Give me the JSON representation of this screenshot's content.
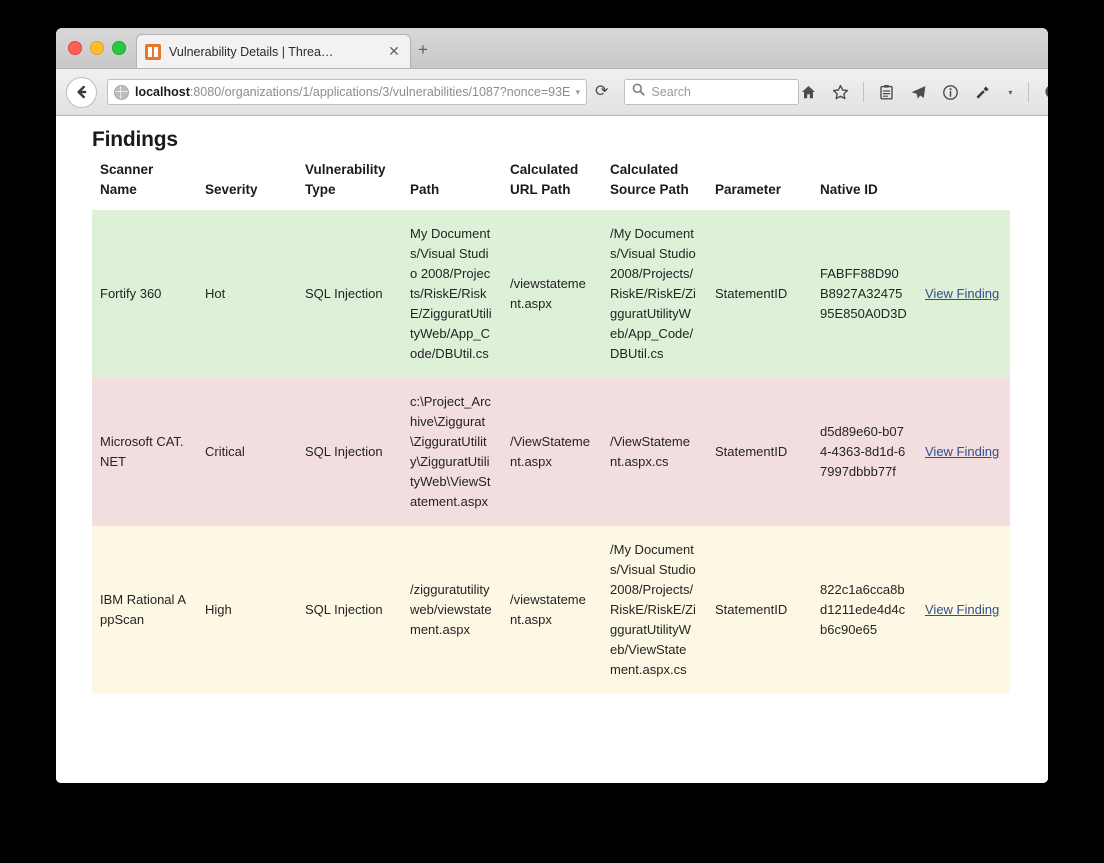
{
  "window": {
    "traffic_lights": [
      "close",
      "minimize",
      "zoom"
    ]
  },
  "tab": {
    "title": "Vulnerability Details | Threa…",
    "close_label": "✕",
    "newtab_label": "+",
    "favicon_name": "threadfix-favicon"
  },
  "navbar": {
    "back_label": "",
    "url_host": "localhost",
    "url_rest": ":8080/organizations/1/applications/3/vulnerabilities/1087?nonce=93E",
    "url_caret": "▾",
    "reload_label": "⟳",
    "search_placeholder": "Search",
    "icons": [
      {
        "name": "home-icon"
      },
      {
        "name": "bookmark-star-icon"
      },
      {
        "name": "reading-list-icon"
      },
      {
        "name": "pocket-send-icon"
      },
      {
        "name": "page-info-icon"
      },
      {
        "name": "addon-icon"
      },
      {
        "name": "dropdown-caret-icon",
        "label": "▾"
      },
      {
        "name": "feedback-smiley-icon"
      },
      {
        "name": "hamburger-menu-icon"
      }
    ]
  },
  "page": {
    "title": "Findings",
    "table": {
      "headers": [
        "Scanner Name",
        "Severity",
        "Vulnerability Type",
        "Path",
        "Calculated URL Path",
        "Calculated Source Path",
        "Parameter",
        "Native ID",
        ""
      ],
      "action_label": "View Finding",
      "rows": [
        {
          "severity_class": "sev-hot",
          "scanner_name": "Fortify 360",
          "severity": "Hot",
          "vulnerability_type": "SQL Injection",
          "path": "My Documents/Visual Studio 2008/Projects/RiskE/RiskE/ZigguratUtilityWeb/App_Code/DBUtil.cs",
          "calculated_url_path": "/viewstatement.aspx",
          "calculated_source_path": "/My Documents/Visual Studio 2008/Projects/RiskE/RiskE/ZigguratUtilityWeb/App_Code/DBUtil.cs",
          "parameter": "StatementID",
          "native_id": "FABFF88D90B8927A3247595E850A0D3D",
          "action": "View Finding"
        },
        {
          "severity_class": "sev-critical",
          "scanner_name": "Microsoft CAT.NET",
          "severity": "Critical",
          "vulnerability_type": "SQL Injection",
          "path": "c:\\Project_Archive\\Ziggurat\\ZigguratUtility\\ZigguratUtilityWeb\\ViewStatement.aspx",
          "calculated_url_path": "/ViewStatement.aspx",
          "calculated_source_path": "/ViewStatement.aspx.cs",
          "parameter": "StatementID",
          "native_id": "d5d89e60-b074-4363-8d1d-67997dbbb77f",
          "action": "View Finding"
        },
        {
          "severity_class": "sev-high",
          "scanner_name": "IBM Rational AppScan",
          "severity": "High",
          "vulnerability_type": "SQL Injection",
          "path": "/zigguratutilityweb/viewstatement.aspx",
          "calculated_url_path": "/viewstatement.aspx",
          "calculated_source_path": "/My Documents/Visual Studio 2008/Projects/RiskE/RiskE/ZigguratUtilityWeb/ViewStatement.aspx.cs",
          "parameter": "StatementID",
          "native_id": "822c1a6cca8bd1211ede4d4cb6c90e65",
          "action": "View Finding"
        }
      ]
    }
  },
  "colors": {
    "row_hot": "#dff0d8",
    "row_critical": "#f2dede",
    "row_high": "#fcf8e3",
    "link": "#2f4f8f",
    "favicon": "#e8762c"
  }
}
